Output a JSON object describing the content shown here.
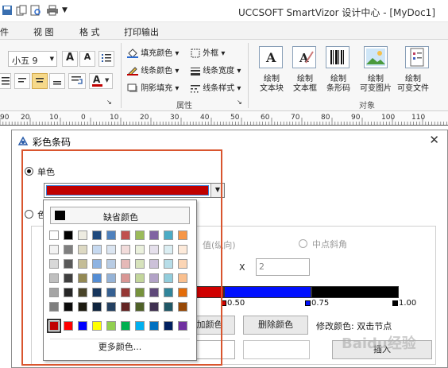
{
  "window": {
    "title": "UCCSOFT SmartVizor 设计中心 - [MyDoc1]"
  },
  "quick_access": [
    "save-icon",
    "copy-icon",
    "preview-icon",
    "print-icon",
    "dropdown-icon"
  ],
  "menu": [
    "件",
    "视 图",
    "格 式",
    "打印输出"
  ],
  "ribbon": {
    "font_size": "小五 9",
    "font_size_options_arrow": "▼",
    "grow_font": "A",
    "shrink_font": "A",
    "fill_color": "填充颜色",
    "line_color": "线条颜色",
    "shadow_fill": "阴影填充",
    "outer_frame": "外框",
    "line_width": "线条宽度",
    "line_style": "线条样式",
    "group_attributes": "属性",
    "group_objects": "对象",
    "draw_buttons": [
      {
        "line1": "绘制",
        "line2": "文本块"
      },
      {
        "line1": "绘制",
        "line2": "文本框"
      },
      {
        "line1": "绘制",
        "line2": "条形码"
      },
      {
        "line1": "绘制",
        "line2": "可变图片"
      },
      {
        "line1": "绘制",
        "line2": "可变文件"
      }
    ]
  },
  "ruler": {
    "ticks": [
      "90",
      "20",
      "10",
      "0",
      "10",
      "20",
      "30",
      "40",
      "50",
      "60",
      "70",
      "80",
      "90",
      "100",
      "110"
    ]
  },
  "dialog": {
    "title": "彩色条码",
    "close": "✕",
    "radio_single": "单色",
    "radio_multi": "色",
    "direction_label": "值(纵向)",
    "radio_center": "中点斜角",
    "x_label": "X",
    "x_value": "2",
    "stop_050": "0.50",
    "stop_075": "0.75",
    "stop_100": "1.00",
    "btn_add_color": "加颜色",
    "btn_delete_color": "删除颜色",
    "modify_hint": "修改颜色: 双击节点",
    "btn_insert": "插入"
  },
  "color_picker": {
    "auto_label": "缺省颜色",
    "more_label": "更多颜色...",
    "selected_color": "#c00000",
    "rows": [
      [
        "#ffffff",
        "#000000",
        "#eeece1",
        "#1f497d",
        "#4f81bd",
        "#c0504d",
        "#9bbb59",
        "#8064a2",
        "#4bacc6",
        "#f79646"
      ],
      [
        "#f2f2f2",
        "#7f7f7f",
        "#ddd9c3",
        "#c6d9f0",
        "#dbe5f1",
        "#f2dcdb",
        "#ebf1dd",
        "#e5e0ec",
        "#dbeef3",
        "#fdeada"
      ],
      [
        "#d8d8d8",
        "#595959",
        "#c4bd97",
        "#8db3e2",
        "#b8cce4",
        "#e5b9b7",
        "#d7e3bc",
        "#ccc1d9",
        "#b7dde8",
        "#fbd5b5"
      ],
      [
        "#bfbfbf",
        "#3f3f3f",
        "#938953",
        "#548dd4",
        "#95b3d7",
        "#d99694",
        "#c3d69b",
        "#b2a2c7",
        "#92cddc",
        "#fac08f"
      ],
      [
        "#a5a5a5",
        "#262626",
        "#494429",
        "#17365d",
        "#366092",
        "#953734",
        "#76923c",
        "#5f497a",
        "#31859b",
        "#e36c09"
      ],
      [
        "#7f7f7f",
        "#0c0c0c",
        "#1d1b10",
        "#0f243e",
        "#244061",
        "#632423",
        "#4f6128",
        "#3f3151",
        "#205867",
        "#974806"
      ],
      [
        "#c00000",
        "#ff0000",
        "#0000ff",
        "#ffff00",
        "#92d050",
        "#00b050",
        "#00b0f0",
        "#0070c0",
        "#002060",
        "#7030a0"
      ]
    ]
  },
  "watermark": "Baidu经验"
}
